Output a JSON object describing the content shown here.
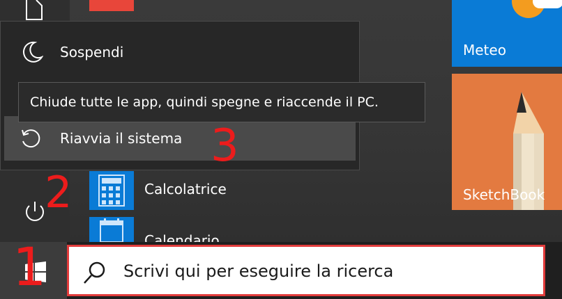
{
  "power_menu": {
    "sleep_label": "Sospendi",
    "restart_label": "Riavvia il sistema",
    "tooltip": "Chiude tutte le app, quindi spegne e riaccende il PC."
  },
  "apps": [
    {
      "label": "Calcolatrice",
      "icon": "calculator-icon"
    },
    {
      "label": "Calendario",
      "icon": "calendar-icon"
    }
  ],
  "tiles": {
    "meteo": {
      "label": "Meteo",
      "color": "#0a7bd6"
    },
    "sketchbook": {
      "label": "SketchBook",
      "color": "#e37a40"
    }
  },
  "taskbar": {
    "search_placeholder": "Scrivi qui per eseguire la ricerca",
    "start_icon": "windows-logo-icon"
  },
  "annotations": {
    "step1": "1",
    "step2": "2",
    "step3": "3",
    "color": "#ec1c1c"
  },
  "icons": {
    "sleep": "moon-icon",
    "restart": "restart-icon",
    "power": "power-icon",
    "search": "search-icon"
  }
}
